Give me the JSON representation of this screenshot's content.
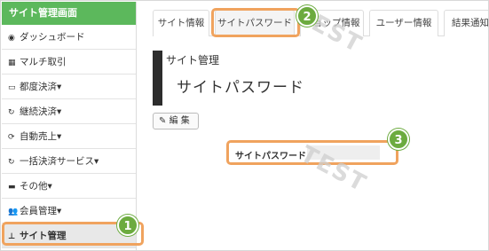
{
  "sidebar": {
    "header": "サイト管理画面",
    "items": [
      {
        "icon": "dashboard-icon",
        "glyph": "◉",
        "label": "ダッシュボード"
      },
      {
        "icon": "grid-icon",
        "glyph": "▦",
        "label": "マルチ取引"
      },
      {
        "icon": "card-icon",
        "glyph": "▭",
        "label": "都度決済▾"
      },
      {
        "icon": "refresh-icon",
        "glyph": "↻",
        "label": "継続決済▾"
      },
      {
        "icon": "sync-icon",
        "glyph": "⟳",
        "label": "自動売上▾"
      },
      {
        "icon": "refresh-icon",
        "glyph": "↻",
        "label": "一括決済サービス▾"
      },
      {
        "icon": "folder-icon",
        "glyph": "▬",
        "label": "その他▾"
      },
      {
        "icon": "users-icon",
        "glyph": "👥",
        "label": "会員管理▾"
      },
      {
        "icon": "sitemap-icon",
        "glyph": "⊥",
        "label": "サイト管理"
      }
    ]
  },
  "tabs": [
    "サイト情報",
    "サイトパスワード",
    "ショップ情報",
    "ユーザー情報",
    "結果通知"
  ],
  "section_label": "サイト管理",
  "page_title": "サイトパスワード",
  "edit_button": "編 集",
  "password": {
    "label": "サイトパスワード",
    "value": ""
  },
  "badges": [
    "1",
    "2",
    "3"
  ],
  "watermark": "TEST",
  "colors": {
    "accent_green": "#5cb85c",
    "highlight_orange": "#f0a35e",
    "badge_green": "#6cab3f"
  }
}
